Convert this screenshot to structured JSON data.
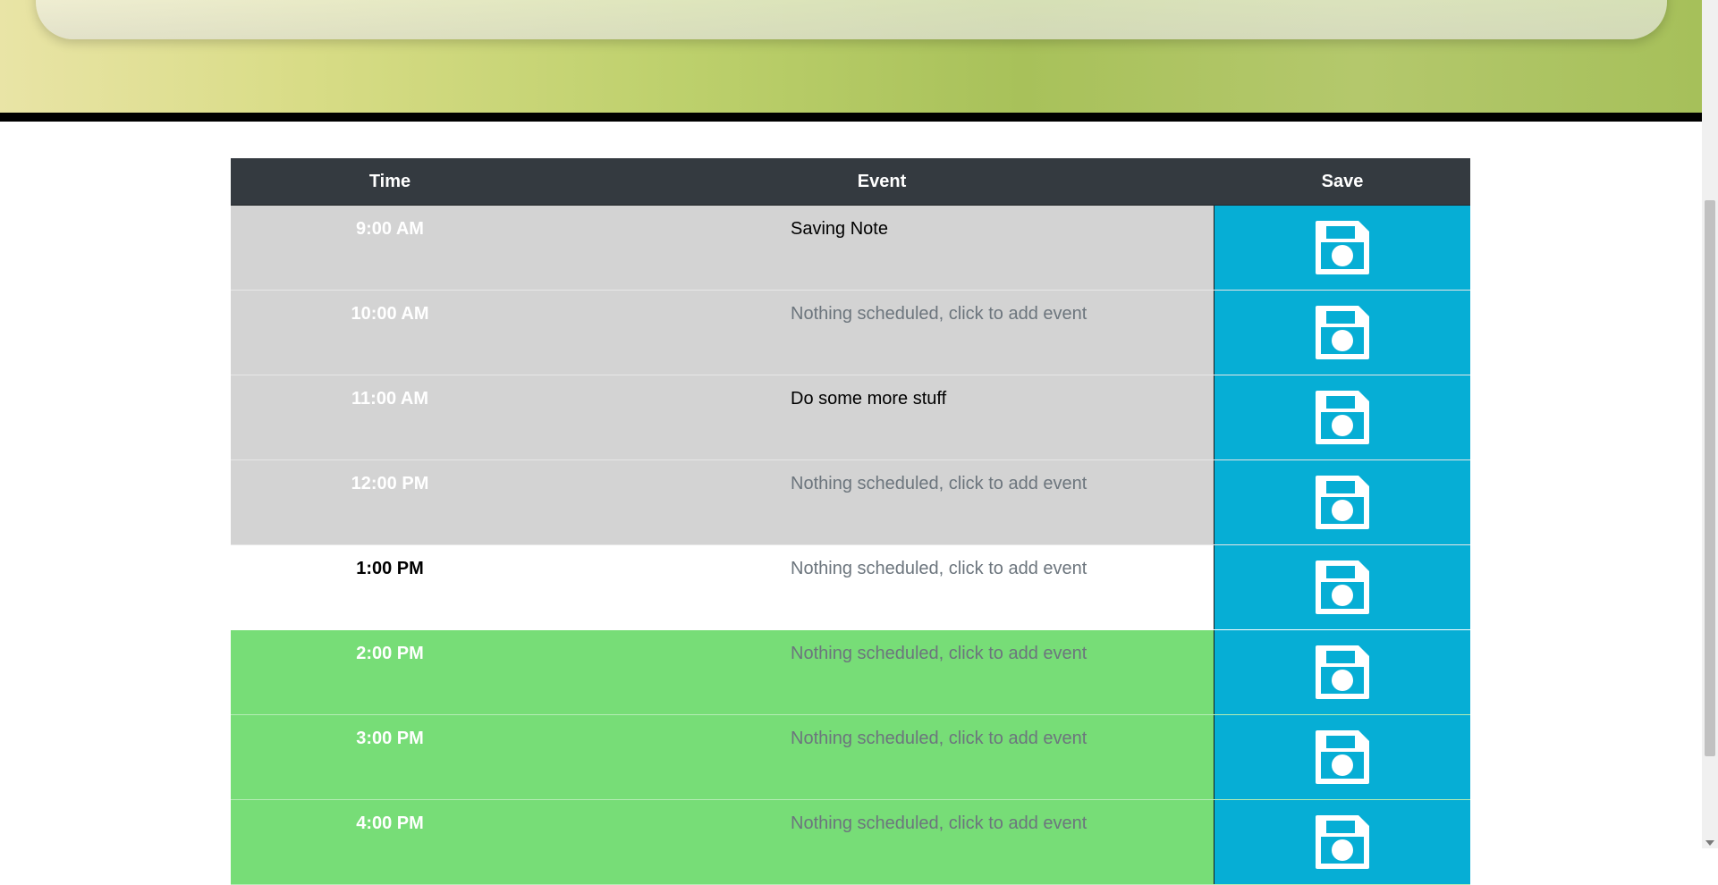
{
  "header": {
    "time_label": "Time",
    "event_label": "Event",
    "save_label": "Save"
  },
  "hours": [
    {
      "time": "9:00 AM",
      "event": "Saving Note",
      "state": "past",
      "has_event": true
    },
    {
      "time": "10:00 AM",
      "event": "Nothing scheduled, click to add event",
      "state": "past",
      "has_event": false
    },
    {
      "time": "11:00 AM",
      "event": "Do some more stuff",
      "state": "past",
      "has_event": true
    },
    {
      "time": "12:00 PM",
      "event": "Nothing scheduled, click to add event",
      "state": "past",
      "has_event": false
    },
    {
      "time": "1:00 PM",
      "event": "Nothing scheduled, click to add event",
      "state": "present",
      "has_event": false
    },
    {
      "time": "2:00 PM",
      "event": "Nothing scheduled, click to add event",
      "state": "future",
      "has_event": false
    },
    {
      "time": "3:00 PM",
      "event": "Nothing scheduled, click to add event",
      "state": "future",
      "has_event": false
    },
    {
      "time": "4:00 PM",
      "event": "Nothing scheduled, click to add event",
      "state": "future",
      "has_event": false
    }
  ],
  "colors": {
    "past": "#d3d3d3",
    "present": "#ffffff",
    "future": "#77dd77",
    "save": "#06aed5",
    "header": "#343a40"
  },
  "icons": {
    "save": "floppy-disk-icon"
  }
}
